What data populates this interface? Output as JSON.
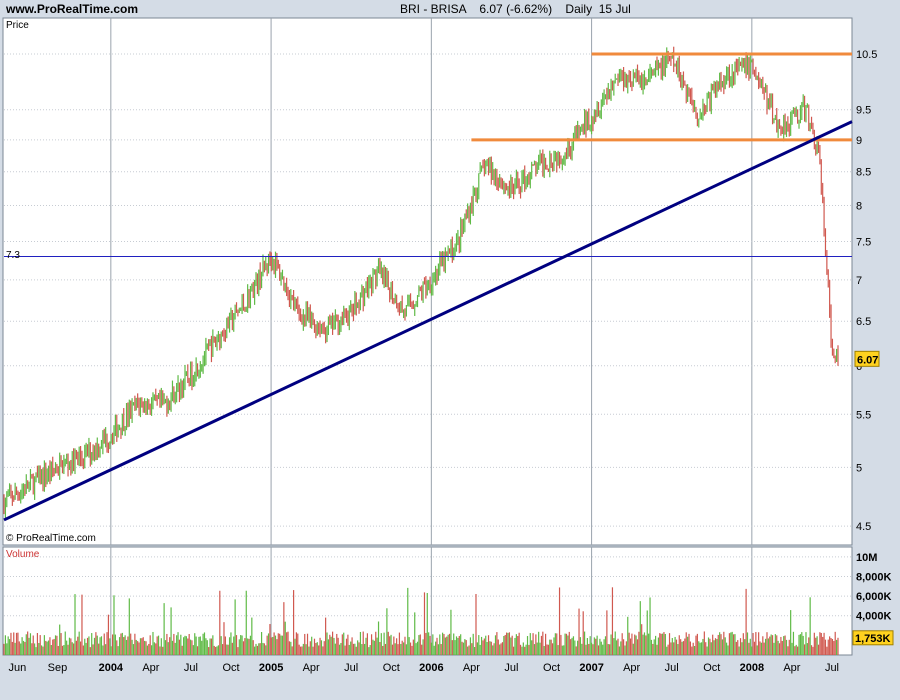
{
  "header": {
    "site": "www.ProRealTime.com",
    "title": "BRI - BRISA",
    "last": "6.07 (-6.62%)",
    "period": "Daily  15 Jul"
  },
  "price_panel": {
    "label": "Price",
    "watermark": "© ProRealTime.com",
    "hline_label": "7.3"
  },
  "volume_panel": {
    "label": "Volume",
    "last_label": "1,753K"
  },
  "colors": {
    "up": "#5fba46",
    "down": "#d0584f",
    "trend": "#000080",
    "resistance": "#f08a3c",
    "hline": "#2020c0",
    "badge": "#ffd21f"
  },
  "chart_data": [
    {
      "type": "line",
      "title": "BRI - BRISA  6.07 (-6.62%)  Daily  15 Jul",
      "xlabel": "",
      "ylabel": "Price",
      "x_ticks": [
        "Jun",
        "Sep",
        "2004",
        "Apr",
        "Jul",
        "Oct",
        "2005",
        "Apr",
        "Jul",
        "Oct",
        "2006",
        "Apr",
        "Jul",
        "Oct",
        "2007",
        "Apr",
        "Jul",
        "Oct",
        "2008",
        "Apr",
        "Jul"
      ],
      "bold_ticks": [
        "2004",
        "2005",
        "2006",
        "2007",
        "2008"
      ],
      "y_ticks": [
        "10.5",
        "9.5",
        "9",
        "8.5",
        "8",
        "7.5",
        "7",
        "6.5",
        "6",
        "5.5",
        "5",
        "4.5"
      ],
      "scale": "log",
      "ylim": [
        4.35,
        11.2
      ],
      "x_range": [
        "2003-05",
        "2008-07-15"
      ],
      "last_value": 6.07,
      "series": [
        {
          "x": [
            "2003-05",
            "2003-07",
            "2003-09",
            "2003-11",
            "2004-01",
            "2004-03",
            "2004-05",
            "2004-07",
            "2004-09",
            "2004-11",
            "2005-01",
            "2005-03",
            "2005-05",
            "2005-07",
            "2005-09",
            "2005-11",
            "2006-01",
            "2006-03",
            "2006-05",
            "2006-07",
            "2006-09",
            "2006-11",
            "2007-01",
            "2007-03",
            "2007-05",
            "2007-07",
            "2007-09",
            "2007-11",
            "2008-01",
            "2008-03",
            "2008-05",
            "2008-06",
            "2008-07"
          ],
          "values": [
            4.7,
            4.85,
            5.0,
            5.1,
            5.3,
            5.6,
            5.6,
            5.9,
            6.3,
            6.7,
            7.3,
            6.6,
            6.4,
            6.6,
            7.1,
            6.6,
            7.0,
            7.5,
            8.6,
            8.2,
            8.6,
            8.8,
            9.4,
            10.1,
            10.0,
            10.4,
            9.4,
            10.1,
            10.3,
            9.2,
            9.5,
            8.8,
            6.07
          ]
        }
      ],
      "annotations": {
        "horizontal_line": 7.3,
        "resistance_levels": [
          {
            "y": 10.5,
            "x_start": "2007-01",
            "x_end": "2008-07"
          },
          {
            "y": 9.0,
            "x_start": "2006-04",
            "x_end": "2008-07"
          }
        ],
        "trend_line": {
          "from": [
            "2003-05",
            4.55
          ],
          "to": [
            "2008-07",
            9.3
          ]
        }
      },
      "grid": true,
      "legend": "none"
    },
    {
      "type": "bar",
      "title": "Volume",
      "y_ticks": [
        "10M",
        "8,000K",
        "6,000K",
        "4,000K"
      ],
      "ylim": [
        0,
        11000000
      ],
      "last_value": 1753000,
      "grid": true,
      "legend": "none"
    }
  ]
}
